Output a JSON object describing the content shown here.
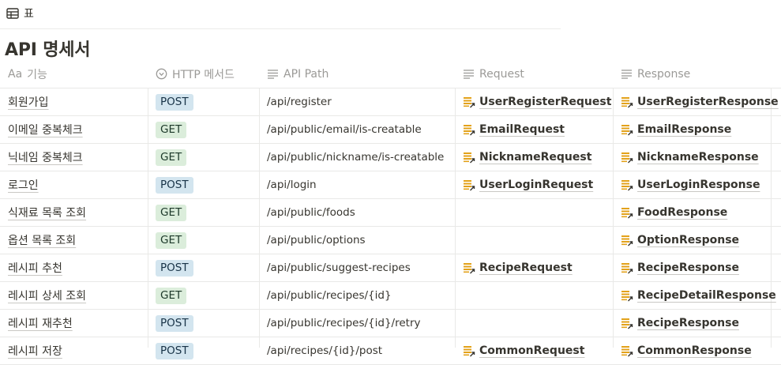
{
  "view": {
    "tab_label": "표",
    "icon": "table-icon"
  },
  "page": {
    "title": "API 명세서"
  },
  "columns": [
    {
      "label": "기능",
      "icon": "title-aa-icon",
      "prefix": "Aa"
    },
    {
      "label": "HTTP 메서드",
      "icon": "select-chevron-icon"
    },
    {
      "label": "API Path",
      "icon": "text-lines-icon"
    },
    {
      "label": "Request",
      "icon": "text-lines-icon"
    },
    {
      "label": "Response",
      "icon": "text-lines-icon"
    }
  ],
  "rows": [
    {
      "name": "회원가입",
      "method": "POST",
      "path": "/api/register",
      "request": "UserRegisterRequest",
      "response": "UserRegisterResponse"
    },
    {
      "name": "이메일 중복체크",
      "method": "GET",
      "path": "/api/public/email/is-creatable",
      "request": "EmailRequest",
      "response": "EmailResponse"
    },
    {
      "name": "닉네임 중복체크",
      "method": "GET",
      "path": "/api/public/nickname/is-creatable",
      "request": "NicknameRequest",
      "response": "NicknameResponse"
    },
    {
      "name": "로그인",
      "method": "POST",
      "path": "/api/login",
      "request": "UserLoginRequest",
      "response": "UserLoginResponse"
    },
    {
      "name": "식재료 목록 조회",
      "method": "GET",
      "path": "/api/public/foods",
      "request": "",
      "response": "FoodResponse"
    },
    {
      "name": "옵션 목록 조회",
      "method": "GET",
      "path": "/api/public/options",
      "request": "",
      "response": "OptionResponse"
    },
    {
      "name": "레시피 추천",
      "method": "POST",
      "path": "/api/public/suggest-recipes",
      "request": "RecipeRequest",
      "response": "RecipeResponse"
    },
    {
      "name": "레시피 상세 조회",
      "method": "GET",
      "path": "/api/public/recipes/{id}",
      "request": "",
      "response": "RecipeDetailResponse"
    },
    {
      "name": "레시피 재추천",
      "method": "POST",
      "path": "/api/public/recipes/{id}/retry",
      "request": "",
      "response": "RecipeResponse"
    },
    {
      "name": "레시피 저장",
      "method": "POST",
      "path": "/api/recipes/{id}/post",
      "request": "CommonRequest",
      "response": "CommonResponse"
    }
  ],
  "colors": {
    "post_bg": "#d3e5ef",
    "get_bg": "#dbeddb",
    "page_icon": "#e3a21a"
  }
}
